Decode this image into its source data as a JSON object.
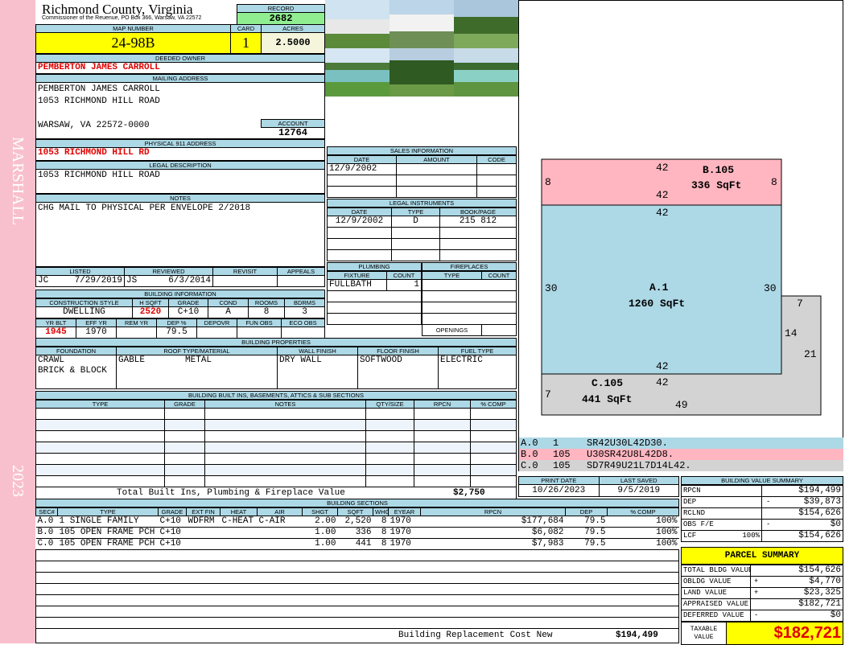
{
  "sidebar": {
    "district": "MARSHALL",
    "year": "2023"
  },
  "header": {
    "county": "Richmond County, Virginia",
    "office": "Commissioner of the Reuenue, PO Box 366, Warsaw, VA 22572",
    "record_label": "RECORD",
    "record": "2682",
    "map_label": "MAP NUMBER",
    "map": "24-98B",
    "card_label": "CARD",
    "card": "1",
    "acres_label": "ACRES",
    "acres": "2.5000"
  },
  "owner": {
    "label": "DEEDED OWNER",
    "name": "PEMBERTON JAMES CARROLL"
  },
  "mailing": {
    "label": "MAILING ADDRESS",
    "line1": "PEMBERTON JAMES CARROLL",
    "line2": "1053 RICHMOND HILL ROAD",
    "line3": "WARSAW, VA 22572-0000",
    "account_label": "ACCOUNT",
    "account": "12764"
  },
  "physical": {
    "label": "PHYSICAL 911 ADDRESS",
    "value": "1053 RICHMOND HILL RD"
  },
  "legal": {
    "label": "LEGAL DESCRIPTION",
    "value": "1053 RICHMOND HILL ROAD"
  },
  "notes": {
    "label": "NOTES",
    "value": "CHG MAIL TO PHYSICAL PER ENVELOPE 2/2018"
  },
  "listing": {
    "headers": [
      "LISTED",
      "REVIEWED",
      "REVISIT",
      "APPEALS"
    ],
    "listed_by": "JC",
    "listed": "7/29/2019",
    "reviewed_by": "JS",
    "reviewed": "6/3/2014"
  },
  "building_info": {
    "label": "BUILDING INFORMATION",
    "h1": [
      "CONSTRUCTION STYLE",
      "H SQFT",
      "GRADE",
      "COND",
      "ROOMS",
      "BDRMS"
    ],
    "v1": [
      "DWELLING",
      "2520",
      "C+10",
      "A",
      "8",
      "3"
    ],
    "h2": [
      "YR BLT",
      "EFF YR",
      "REM YR",
      "DEP %",
      "DEPOVR",
      "FUN OBS",
      "ECO OBS"
    ],
    "v2": [
      "1945",
      "1970",
      "",
      "79.5",
      "",
      "",
      ""
    ]
  },
  "properties": {
    "label": "BUILDING PROPERTIES",
    "headers": [
      "FOUNDATION",
      "ROOF TYPE/MATERIAL",
      "WALL FINISH",
      "FLOOR FINISH",
      "FUEL TYPE"
    ],
    "foundation1": "CRAWL",
    "foundation2": "BRICK & BLOCK",
    "roof_type": "GABLE",
    "roof_material": "METAL",
    "wall": "DRY WALL",
    "floor": "SOFTWOOD",
    "fuel": "ELECTRIC"
  },
  "builtins": {
    "label": "BUILDING BUILT INS, BASEMENTS, ATTICS & SUB SECTIONS",
    "headers": [
      "TYPE",
      "GRADE",
      "NOTES",
      "QTY/SIZE",
      "RPCN",
      "% COMP"
    ],
    "total_label": "Total Built Ins, Plumbing & Fireplace Value",
    "total": "$2,750"
  },
  "sales": {
    "label": "SALES INFORMATION",
    "headers": [
      "DATE",
      "AMOUNT",
      "CODE"
    ],
    "rows": [
      [
        "12/9/2002",
        "",
        ""
      ]
    ]
  },
  "instruments": {
    "label": "LEGAL INSTRUMENTS",
    "headers": [
      "DATE",
      "TYPE",
      "BOOK/PAGE"
    ],
    "rows": [
      [
        "12/9/2002",
        "D",
        "215 812"
      ]
    ]
  },
  "plumbing": {
    "label": "PLUMBING",
    "headers": [
      "FIXTURE",
      "COUNT"
    ],
    "rows": [
      [
        "FULLBATH",
        "1"
      ]
    ]
  },
  "fireplaces": {
    "label": "FIREPLACES",
    "headers": [
      "TYPE",
      "COUNT"
    ],
    "openings": "OPENINGS"
  },
  "sketch": {
    "sections": [
      {
        "name": "A.1",
        "area": "1260 SqFt",
        "dims": [
          "42",
          "30",
          "42",
          "30"
        ]
      },
      {
        "name": "B.105",
        "area": "336 SqFt",
        "dims": [
          "42",
          "8",
          "42",
          "8"
        ]
      },
      {
        "name": "C.105",
        "area": "441 SqFt",
        "dims": [
          "42",
          "7",
          "49",
          "21",
          "7",
          "14"
        ]
      }
    ],
    "codes": [
      [
        "A.0",
        "1",
        "SR42U30L42D30."
      ],
      [
        "B.0",
        "105",
        "U30SR42U8L42D8."
      ],
      [
        "C.0",
        "105",
        "SD7R49U21L7D14L42."
      ]
    ],
    "colors": {
      "A": "#add8e6",
      "B": "#ffb6c1",
      "C": "#d3d3d3"
    }
  },
  "dates": {
    "print_label": "PRINT DATE",
    "print": "10/26/2023",
    "saved_label": "LAST SAVED",
    "saved": "9/5/2019"
  },
  "sections": {
    "label": "BUILDING SECTIONS",
    "headers": [
      "SEC#",
      "TYPE",
      "GRADE",
      "EXT FIN",
      "HEAT",
      "AIR",
      "SHGT",
      "SQFT",
      "WHGT",
      "EYEAR",
      "RPCN",
      "DEP",
      "% COMP"
    ],
    "rows": [
      [
        "A.0",
        "1 SINGLE FAMILY",
        "C+10",
        "WDFRM",
        "C-HEAT",
        "C-AIR",
        "2.00",
        "2,520",
        "8",
        "1970",
        "$177,684",
        "79.5",
        "100%"
      ],
      [
        "B.0",
        "105 OPEN FRAME PCH",
        "C+10",
        "",
        "",
        "",
        "1.00",
        "336",
        "8",
        "1970",
        "$6,082",
        "79.5",
        "100%"
      ],
      [
        "C.0",
        "105 OPEN FRAME PCH",
        "C+10",
        "",
        "",
        "",
        "1.00",
        "441",
        "8",
        "1970",
        "$7,983",
        "79.5",
        "100%"
      ]
    ],
    "total_label": "Building Replacement Cost New",
    "total": "$194,499"
  },
  "value_summary": {
    "label": "BUILDING VALUE SUMMARY",
    "rows": [
      [
        "RPCN",
        "",
        "",
        "$194,499"
      ],
      [
        "DEP",
        "",
        "-",
        "$39,873"
      ],
      [
        "RCLND",
        "",
        "",
        "$154,626"
      ],
      [
        "OBS F/E",
        "",
        "-",
        "$0"
      ],
      [
        "LCF",
        "100%",
        "",
        "$154,626"
      ]
    ]
  },
  "parcel": {
    "label": "PARCEL SUMMARY",
    "rows": [
      [
        "TOTAL BLDG VALUE",
        "",
        "$154,626"
      ],
      [
        "OBLDG VALUE",
        "+",
        "$4,770"
      ],
      [
        "LAND VALUE",
        "+",
        "$23,325"
      ],
      [
        "APPRAISED VALUE",
        "",
        "$182,721"
      ],
      [
        "DEFERRED VALUE",
        "-",
        "$0"
      ]
    ],
    "taxable_label": "TAXABLE VALUE",
    "taxable": "$182,721"
  }
}
